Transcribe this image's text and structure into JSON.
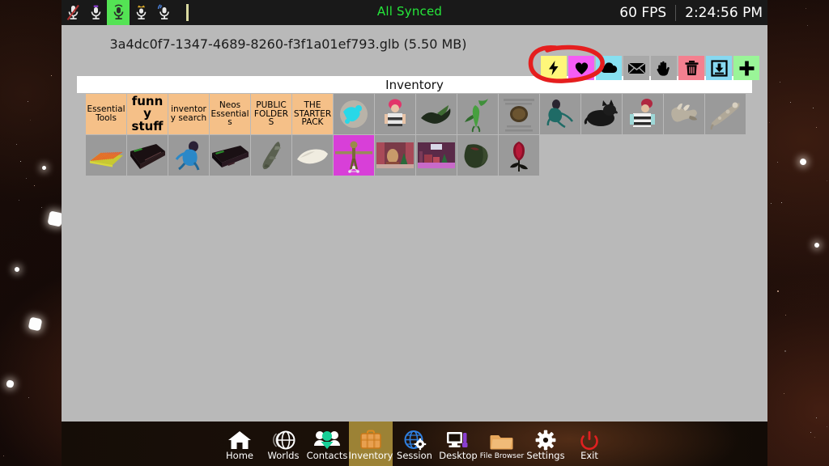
{
  "topbar": {
    "mic_buttons": [
      {
        "name": "mic-muted",
        "state": "muted"
      },
      {
        "name": "mic-whisper",
        "state": "whisper"
      },
      {
        "name": "mic-normal",
        "state": "active"
      },
      {
        "name": "mic-broadcast",
        "state": "broadcast"
      },
      {
        "name": "mic-shout",
        "state": "shout"
      }
    ],
    "sync_status": "All Synced",
    "sync_color": "#25e83a",
    "fps": "60 FPS",
    "clock": "2:24:56 PM"
  },
  "panel": {
    "file_title": "3a4dc0f7-1347-4689-8260-f3f1a01ef793.glb (5.50 MB)",
    "inventory_title": "Inventory"
  },
  "action_toolbar": {
    "buttons": [
      {
        "label": "Lightning",
        "icon": "lightning-bolt-icon",
        "bg": "#fff77a",
        "fg": "#000000"
      },
      {
        "label": "Favorite",
        "icon": "heart-icon",
        "bg": "#f45df4",
        "fg": "#000000"
      },
      {
        "label": "Cloud",
        "icon": "cloud-icon",
        "bg": "#87e0f0",
        "fg": "#000000"
      },
      {
        "label": "Message",
        "icon": "envelope-icon",
        "bg": "#a8a8a8",
        "fg": "#000000"
      },
      {
        "label": "Grab",
        "icon": "hand-icon",
        "bg": "#a8a8a8",
        "fg": "#000000"
      },
      {
        "label": "Delete",
        "icon": "trash-icon",
        "bg": "#f4808f",
        "fg": "#000000"
      },
      {
        "label": "Save",
        "icon": "download-icon",
        "bg": "#87d8f0",
        "fg": "#000000"
      },
      {
        "label": "Add",
        "icon": "plus-icon",
        "bg": "#9af598",
        "fg": "#000000"
      }
    ],
    "annotation": {
      "shape": "hand-drawn-circle",
      "color": "#e51e1e",
      "covers": [
        "Lightning",
        "Favorite"
      ]
    }
  },
  "inventory": {
    "folder_color": "#f5c088",
    "cell_color": "#a7a7a7",
    "rows": [
      [
        {
          "type": "folder",
          "label": "Essential Tools",
          "size": "mid"
        },
        {
          "type": "folder",
          "label": "funny stuff",
          "size": "big"
        },
        {
          "type": "folder",
          "label": "inventory search",
          "size": "mid"
        },
        {
          "type": "folder",
          "label": "Neos Essentials",
          "size": "mid"
        },
        {
          "type": "folder",
          "label": "PUBLIC FOLDERS",
          "size": "mid"
        },
        {
          "type": "folder",
          "label": "THE STARTER PACK",
          "size": "mid"
        },
        {
          "type": "item",
          "thumb": "globe-cyan"
        },
        {
          "type": "item",
          "thumb": "pink-hair-character"
        },
        {
          "type": "item",
          "thumb": "dark-green-creature"
        },
        {
          "type": "item",
          "thumb": "green-figure"
        },
        {
          "type": "item",
          "thumb": "coin-badge"
        },
        {
          "type": "item",
          "thumb": "teal-crawling-figure"
        },
        {
          "type": "item",
          "thumb": "black-dog"
        },
        {
          "type": "item",
          "thumb": "red-cap-character"
        },
        {
          "type": "item",
          "thumb": "metal-prop"
        },
        {
          "type": "item",
          "thumb": "metal-rifle"
        }
      ],
      [
        {
          "type": "item",
          "thumb": "orange-grid-mat"
        },
        {
          "type": "item",
          "thumb": "dark-console"
        },
        {
          "type": "item",
          "thumb": "blue-figure"
        },
        {
          "type": "item",
          "thumb": "dark-sofa"
        },
        {
          "type": "item",
          "thumb": "gray-rifle"
        },
        {
          "type": "item",
          "thumb": "white-blob"
        },
        {
          "type": "item",
          "thumb": "magenta-tpose-avatar"
        },
        {
          "type": "item",
          "thumb": "room-scene-a"
        },
        {
          "type": "item",
          "thumb": "room-scene-b"
        },
        {
          "type": "item",
          "thumb": "green-dark-creature"
        },
        {
          "type": "item",
          "thumb": "red-rose"
        }
      ]
    ]
  },
  "bottom_nav": {
    "items": [
      {
        "label": "Home",
        "icon": "home-icon",
        "selected": false
      },
      {
        "label": "Worlds",
        "icon": "globe-worlds-icon",
        "selected": false
      },
      {
        "label": "Contacts",
        "icon": "contacts-people-icon",
        "selected": false
      },
      {
        "label": "Inventory",
        "icon": "briefcase-icon",
        "selected": true
      },
      {
        "label": "Session",
        "icon": "globe-gear-icon",
        "selected": false
      },
      {
        "label": "Desktop",
        "icon": "monitor-icon",
        "selected": false
      },
      {
        "label": "File Browser",
        "icon": "folder-icon",
        "selected": false,
        "small": true
      },
      {
        "label": "Settings",
        "icon": "gear-icon",
        "selected": false
      },
      {
        "label": "Exit",
        "icon": "power-icon",
        "selected": false
      }
    ],
    "selected_bg": "#9c8235"
  }
}
